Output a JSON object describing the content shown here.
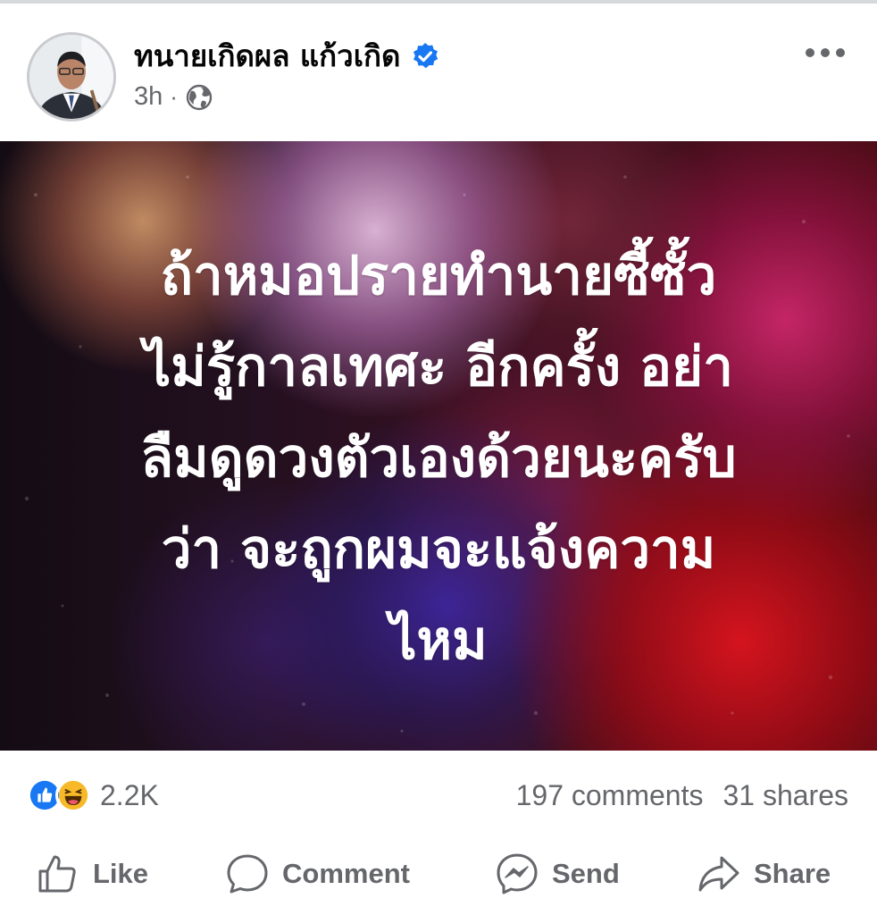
{
  "post": {
    "author_name": "ทนายเกิดผล แก้วเกิด",
    "time": "3h",
    "separator": "·",
    "text_lines": [
      "ถ้าหมอปรายทำนายซี้ซั้ว",
      "ไม่รู้กาลเทศะ อีกครั้ง อย่า",
      "ลืมดูดวงตัวเองด้วยนะครับ",
      "ว่า จะถูกผมจะแจ้งความ",
      "ไหม"
    ],
    "text_color": "#ffffff"
  },
  "stats": {
    "reaction_count": "2.2K",
    "comments": "197 comments",
    "shares": "31 shares"
  },
  "actions": {
    "like": "Like",
    "comment": "Comment",
    "send": "Send",
    "share": "Share"
  },
  "colors": {
    "accent": "#1877f2",
    "secondary_text": "#65676b",
    "primary_text": "#050505",
    "haha_yellow": "#f7b928"
  },
  "icons": [
    "verified-badge-icon",
    "globe-icon",
    "more-options-icon",
    "like-reaction-icon",
    "haha-reaction-icon",
    "thumbs-up-icon",
    "comment-icon",
    "messenger-icon",
    "share-arrow-icon"
  ]
}
